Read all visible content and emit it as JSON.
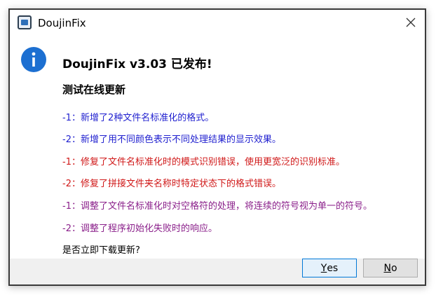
{
  "window": {
    "title": "DoujinFix",
    "app_icon": "app-icon"
  },
  "dialog": {
    "icon": "info-icon",
    "heading": "DoujinFix v3.03 已发布!",
    "subheading": "测试在线更新",
    "items": [
      {
        "text": "-1：新增了2种文件名标准化的格式。",
        "color": "#1f1fcf"
      },
      {
        "text": "-2：新增了用不同颜色表示不同处理结果的显示效果。",
        "color": "#1f1fcf"
      },
      {
        "text": "-1：修复了文件名标准化时的模式识别错误，使用更宽泛的识别标准。",
        "color": "#d01818"
      },
      {
        "text": "-2：修复了拼接文件夹名称时特定状态下的格式错误。",
        "color": "#d01818"
      },
      {
        "text": "-1：调整了文件名标准化时对空格符的处理，将连续的符号视为单一的符号。",
        "color": "#8a1f8a"
      },
      {
        "text": "-2：调整了程序初始化失败时的响应。",
        "color": "#8a1f8a"
      }
    ],
    "prompt": "是否立即下载更新?"
  },
  "buttons": {
    "yes_mnemonic": "Y",
    "yes_rest": "es",
    "no_mnemonic": "N",
    "no_rest": "o"
  }
}
